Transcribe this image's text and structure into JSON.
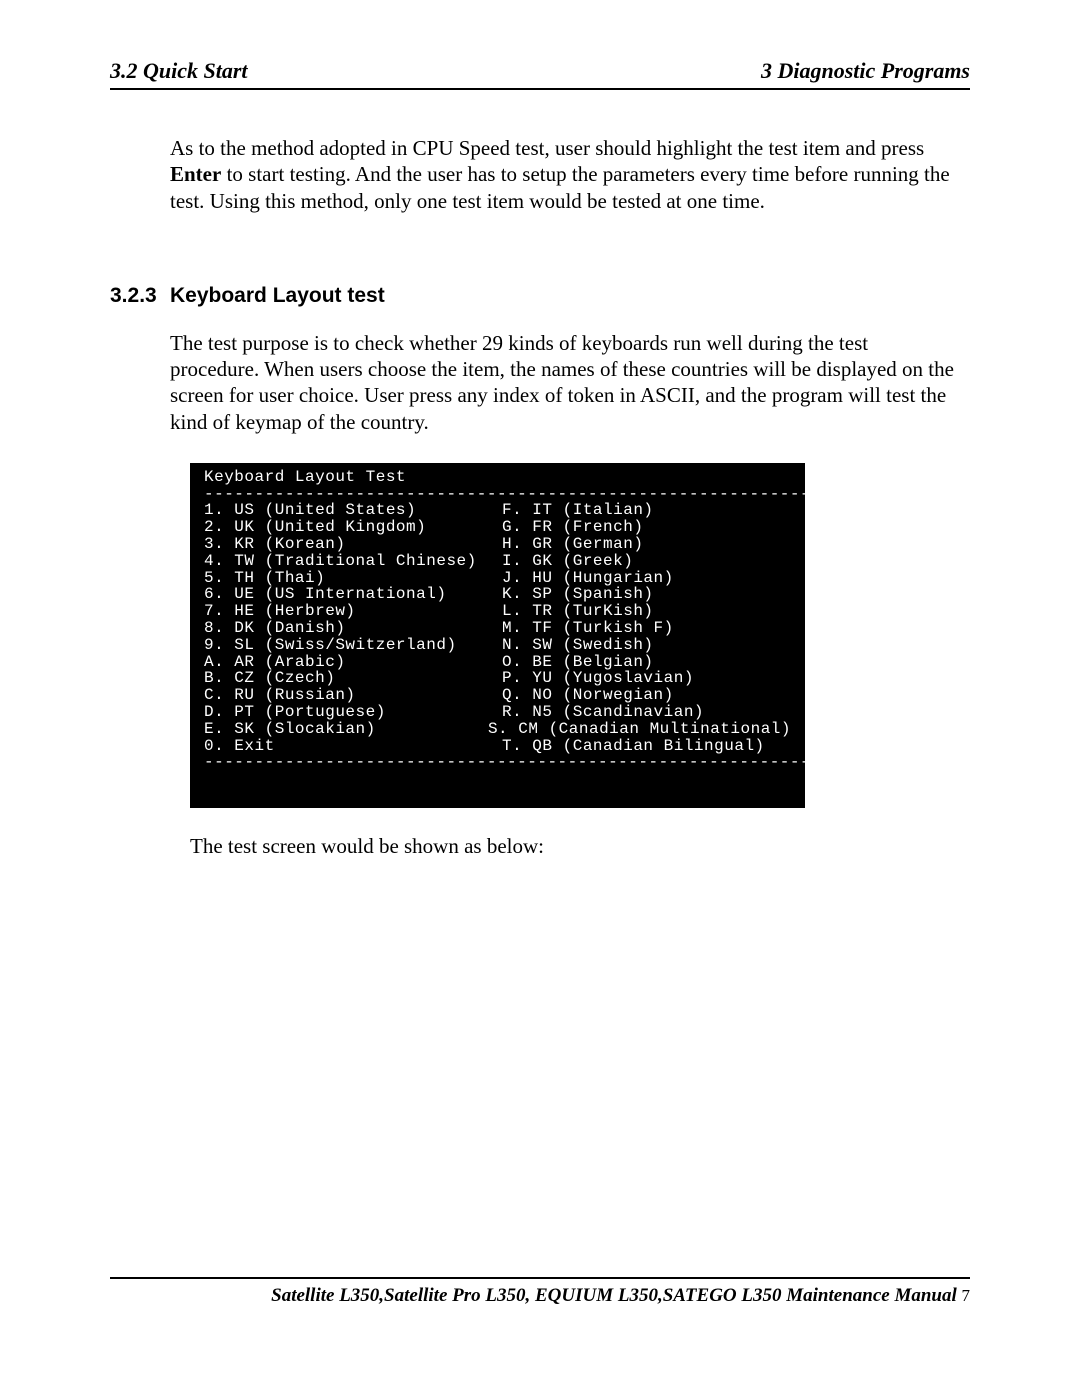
{
  "header": {
    "left": "3.2 Quick Start",
    "right": "3  Diagnostic Programs"
  },
  "para1_a": "As to the method adopted in CPU Speed test, user should highlight the test item and press ",
  "para1_bold": "Enter",
  "para1_b": " to start testing. And the user has to setup the parameters every time before running the test. Using this method, only one test item would be tested at one time.",
  "section": {
    "number": "3.2.3",
    "title": "Keyboard Layout test"
  },
  "para2": "The test purpose is to check whether 29 kinds of keyboards run well during the test procedure. When users choose the item, the names of these countries will be displayed on the screen for user choice. User press any index of token in ASCII, and the program will test the kind of keymap of the country.",
  "terminal": {
    "title": "Keyboard Layout Test",
    "divider": "-----------------------------------------------------------------------------",
    "rows": [
      {
        "l": "1. US (United States)",
        "r": "F. IT (Italian)"
      },
      {
        "l": "2. UK (United Kingdom)",
        "r": "G. FR (French)"
      },
      {
        "l": "3. KR (Korean)",
        "r": "H. GR (German)"
      },
      {
        "l": "4. TW (Traditional Chinese)",
        "r": "I. GK (Greek)"
      },
      {
        "l": "5. TH (Thai)",
        "r": "J. HU (Hungarian)"
      },
      {
        "l": "6. UE (US International)",
        "r": "K. SP (Spanish)"
      },
      {
        "l": "7. HE (Herbrew)",
        "r": "L. TR (TurKish)"
      },
      {
        "l": "8. DK (Danish)",
        "r": "M. TF (Turkish F)"
      },
      {
        "l": "9. SL (Swiss/Switzerland)",
        "r": "N. SW (Swedish)"
      },
      {
        "l": "A. AR (Arabic)",
        "r": "O. BE (Belgian)"
      },
      {
        "l": "B. CZ (Czech)",
        "r": "P. YU (Yugoslavian)"
      },
      {
        "l": "C. RU (Russian)",
        "r": "Q. NO (Norwegian)"
      },
      {
        "l": "D. PT (Portuguese)",
        "r": "R. N5 (Scandinavian)"
      },
      {
        "l": "E. SK (Slocakian)",
        "r": "S. CM (Canadian Multinational)"
      },
      {
        "l": "0. Exit",
        "r": "T. QB (Canadian Bilingual)"
      }
    ]
  },
  "follow": "The test screen would be shown as below:",
  "footer": {
    "title": "Satellite L350,Satellite Pro L350, EQUIUM L350,SATEGO L350 Maintenance Manual",
    "page": "7"
  }
}
